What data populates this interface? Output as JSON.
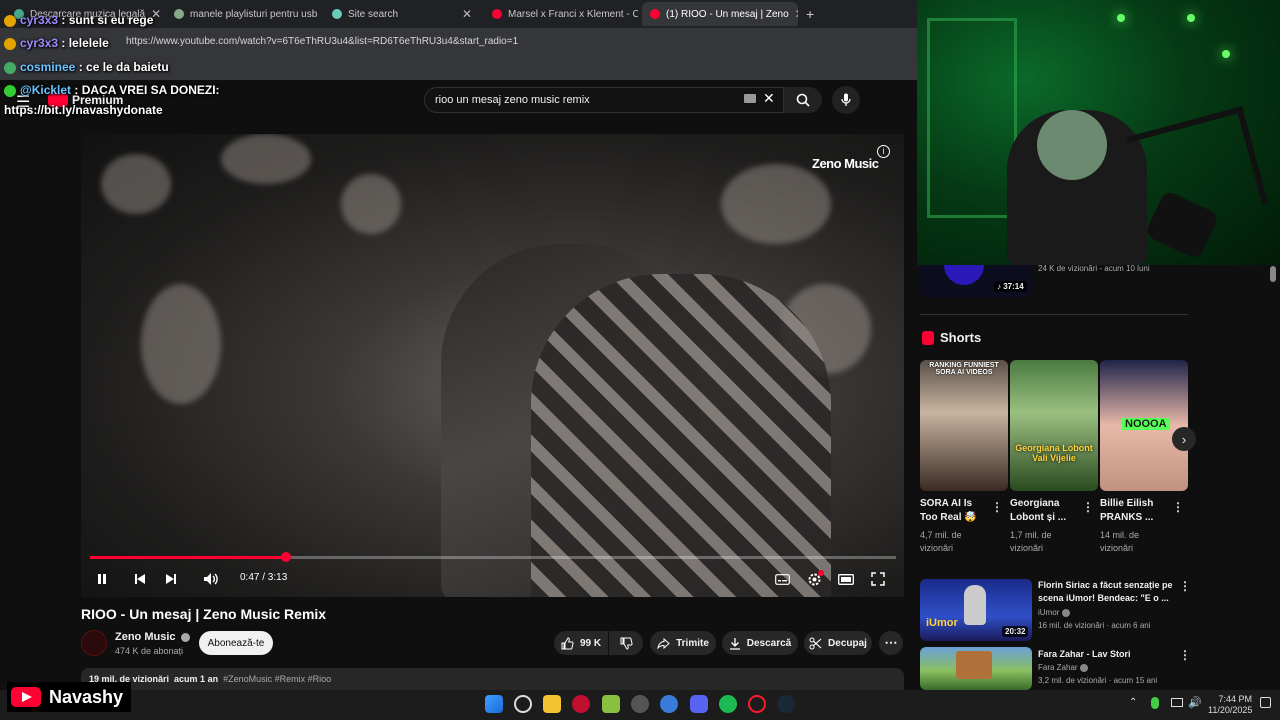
{
  "browser": {
    "tabs": [
      {
        "title": "Descarcare muzica legală",
        "active": false
      },
      {
        "title": "manele playlisturi pentru usb",
        "active": false
      },
      {
        "title": "Site search",
        "active": false
      },
      {
        "title": "Marsel x Franci x Klement - CO",
        "active": false
      },
      {
        "title": "(1) RIOO - Un mesaj | Zeno",
        "active": true
      }
    ],
    "url": "https://www.youtube.com/watch?v=6T6eThRU3u4&list=RD6T6eThRU3u4&start_radio=1"
  },
  "chat": [
    {
      "user": "cyr3x3",
      "message": ": sunt si eu rege"
    },
    {
      "user": "cyr3x3",
      "message": ": lelelele"
    },
    {
      "user": "cosminee",
      "message": ": ce le da baietu"
    },
    {
      "user": "@Kicklet",
      "message": ": DACA VREI SA DONEZI:"
    },
    {
      "user": "",
      "message": "https://bit.ly/navashydonate"
    }
  ],
  "youtube": {
    "logo_text": "Premium",
    "search_query": "rioo un mesaj zeno music remix",
    "video": {
      "watermark": "Zeno Music",
      "current_time": "0:47",
      "duration": "3:13",
      "time_display": "0:47 / 3:13",
      "progress_fraction": 0.243,
      "title": "RIOO - Un mesaj | Zeno Music Remix",
      "channel": "Zeno Music",
      "subscribers": "474 K de abonați",
      "subscribe_label": "Abonează-te",
      "likes": "99 K",
      "share_label": "Trimite",
      "download_label": "Descarcă",
      "clip_label": "Decupaj",
      "views": "19 mil. de vizionări",
      "age": "acum 1 an",
      "tags": "#ZenoMusic #Remix #Rioo"
    },
    "sidebar": {
      "top_item": {
        "duration": "37:14",
        "meta": "24 K de vizionări - acum 10 luni"
      },
      "shorts_heading": "Shorts",
      "shorts": [
        {
          "title": "SORA AI Is Too Real 🤯",
          "views": "4,7 mil. de vizionări",
          "overlay": "RANKING FUNNIEST SORA AI VIDEOS"
        },
        {
          "title": "Georgiana Lobont și ...",
          "views": "1,7 mil. de vizionări",
          "overlay": "Georgiana Lobont Vali Vijelie"
        },
        {
          "title": "Billie Eilish PRANKS ...",
          "views": "14 mil. de vizionări",
          "overlay": "NOOOA"
        }
      ],
      "recommended": [
        {
          "title": "Florin Siriac a făcut senzație pe scena iUmor! Bendeac: \"E o ...",
          "channel": "iUmor",
          "meta": "16 mil. de vizionări · acum 6 ani",
          "duration": "20:32",
          "thumb_text": "iUmor"
        },
        {
          "title": "Fara Zahar - Lav Stori",
          "channel": "Fara Zahar",
          "meta": "3,2 mil. de vizionări · acum 15 ani",
          "duration": "",
          "thumb_text": ""
        }
      ]
    }
  },
  "stream": {
    "streamer_name": "Navashy"
  },
  "taskbar": {
    "time": "7:44 PM",
    "date": "11/20/2025"
  },
  "colors": {
    "youtube_red": "#ff0033",
    "accent_green": "#0b6a2a"
  }
}
